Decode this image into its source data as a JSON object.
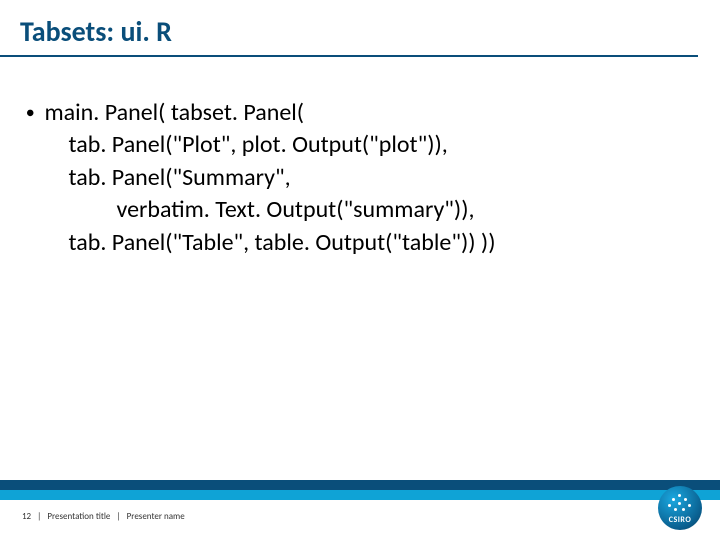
{
  "title": "Tabsets: ui. R",
  "bullet": {
    "lines": [
      "main. Panel( tabset. Panel(",
      "tab. Panel(\"Plot\", plot. Output(\"plot\")),",
      "tab. Panel(\"Summary\",",
      "verbatim. Text. Output(\"summary\")),",
      "tab. Panel(\"Table\", table. Output(\"table\")) ))"
    ]
  },
  "footer": {
    "page": "12",
    "title": "Presentation title",
    "presenter": "Presenter name",
    "sep": "|"
  },
  "logo": {
    "text": "CSIRO"
  }
}
